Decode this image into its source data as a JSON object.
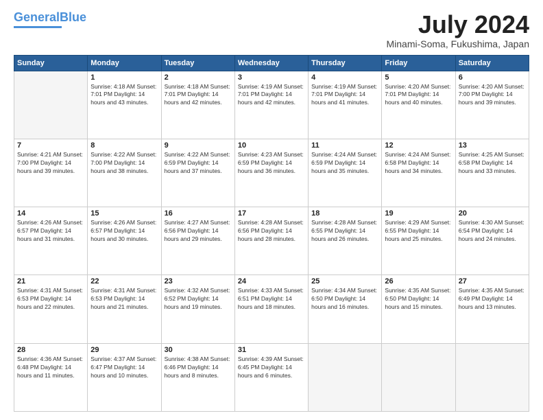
{
  "header": {
    "logo_line1": "General",
    "logo_line2": "Blue",
    "month_year": "July 2024",
    "location": "Minami-Soma, Fukushima, Japan"
  },
  "weekdays": [
    "Sunday",
    "Monday",
    "Tuesday",
    "Wednesday",
    "Thursday",
    "Friday",
    "Saturday"
  ],
  "weeks": [
    [
      {
        "day": "",
        "text": ""
      },
      {
        "day": "1",
        "text": "Sunrise: 4:18 AM\nSunset: 7:01 PM\nDaylight: 14 hours\nand 43 minutes."
      },
      {
        "day": "2",
        "text": "Sunrise: 4:18 AM\nSunset: 7:01 PM\nDaylight: 14 hours\nand 42 minutes."
      },
      {
        "day": "3",
        "text": "Sunrise: 4:19 AM\nSunset: 7:01 PM\nDaylight: 14 hours\nand 42 minutes."
      },
      {
        "day": "4",
        "text": "Sunrise: 4:19 AM\nSunset: 7:01 PM\nDaylight: 14 hours\nand 41 minutes."
      },
      {
        "day": "5",
        "text": "Sunrise: 4:20 AM\nSunset: 7:01 PM\nDaylight: 14 hours\nand 40 minutes."
      },
      {
        "day": "6",
        "text": "Sunrise: 4:20 AM\nSunset: 7:00 PM\nDaylight: 14 hours\nand 39 minutes."
      }
    ],
    [
      {
        "day": "7",
        "text": "Sunrise: 4:21 AM\nSunset: 7:00 PM\nDaylight: 14 hours\nand 39 minutes."
      },
      {
        "day": "8",
        "text": "Sunrise: 4:22 AM\nSunset: 7:00 PM\nDaylight: 14 hours\nand 38 minutes."
      },
      {
        "day": "9",
        "text": "Sunrise: 4:22 AM\nSunset: 6:59 PM\nDaylight: 14 hours\nand 37 minutes."
      },
      {
        "day": "10",
        "text": "Sunrise: 4:23 AM\nSunset: 6:59 PM\nDaylight: 14 hours\nand 36 minutes."
      },
      {
        "day": "11",
        "text": "Sunrise: 4:24 AM\nSunset: 6:59 PM\nDaylight: 14 hours\nand 35 minutes."
      },
      {
        "day": "12",
        "text": "Sunrise: 4:24 AM\nSunset: 6:58 PM\nDaylight: 14 hours\nand 34 minutes."
      },
      {
        "day": "13",
        "text": "Sunrise: 4:25 AM\nSunset: 6:58 PM\nDaylight: 14 hours\nand 33 minutes."
      }
    ],
    [
      {
        "day": "14",
        "text": "Sunrise: 4:26 AM\nSunset: 6:57 PM\nDaylight: 14 hours\nand 31 minutes."
      },
      {
        "day": "15",
        "text": "Sunrise: 4:26 AM\nSunset: 6:57 PM\nDaylight: 14 hours\nand 30 minutes."
      },
      {
        "day": "16",
        "text": "Sunrise: 4:27 AM\nSunset: 6:56 PM\nDaylight: 14 hours\nand 29 minutes."
      },
      {
        "day": "17",
        "text": "Sunrise: 4:28 AM\nSunset: 6:56 PM\nDaylight: 14 hours\nand 28 minutes."
      },
      {
        "day": "18",
        "text": "Sunrise: 4:28 AM\nSunset: 6:55 PM\nDaylight: 14 hours\nand 26 minutes."
      },
      {
        "day": "19",
        "text": "Sunrise: 4:29 AM\nSunset: 6:55 PM\nDaylight: 14 hours\nand 25 minutes."
      },
      {
        "day": "20",
        "text": "Sunrise: 4:30 AM\nSunset: 6:54 PM\nDaylight: 14 hours\nand 24 minutes."
      }
    ],
    [
      {
        "day": "21",
        "text": "Sunrise: 4:31 AM\nSunset: 6:53 PM\nDaylight: 14 hours\nand 22 minutes."
      },
      {
        "day": "22",
        "text": "Sunrise: 4:31 AM\nSunset: 6:53 PM\nDaylight: 14 hours\nand 21 minutes."
      },
      {
        "day": "23",
        "text": "Sunrise: 4:32 AM\nSunset: 6:52 PM\nDaylight: 14 hours\nand 19 minutes."
      },
      {
        "day": "24",
        "text": "Sunrise: 4:33 AM\nSunset: 6:51 PM\nDaylight: 14 hours\nand 18 minutes."
      },
      {
        "day": "25",
        "text": "Sunrise: 4:34 AM\nSunset: 6:50 PM\nDaylight: 14 hours\nand 16 minutes."
      },
      {
        "day": "26",
        "text": "Sunrise: 4:35 AM\nSunset: 6:50 PM\nDaylight: 14 hours\nand 15 minutes."
      },
      {
        "day": "27",
        "text": "Sunrise: 4:35 AM\nSunset: 6:49 PM\nDaylight: 14 hours\nand 13 minutes."
      }
    ],
    [
      {
        "day": "28",
        "text": "Sunrise: 4:36 AM\nSunset: 6:48 PM\nDaylight: 14 hours\nand 11 minutes."
      },
      {
        "day": "29",
        "text": "Sunrise: 4:37 AM\nSunset: 6:47 PM\nDaylight: 14 hours\nand 10 minutes."
      },
      {
        "day": "30",
        "text": "Sunrise: 4:38 AM\nSunset: 6:46 PM\nDaylight: 14 hours\nand 8 minutes."
      },
      {
        "day": "31",
        "text": "Sunrise: 4:39 AM\nSunset: 6:45 PM\nDaylight: 14 hours\nand 6 minutes."
      },
      {
        "day": "",
        "text": ""
      },
      {
        "day": "",
        "text": ""
      },
      {
        "day": "",
        "text": ""
      }
    ]
  ]
}
